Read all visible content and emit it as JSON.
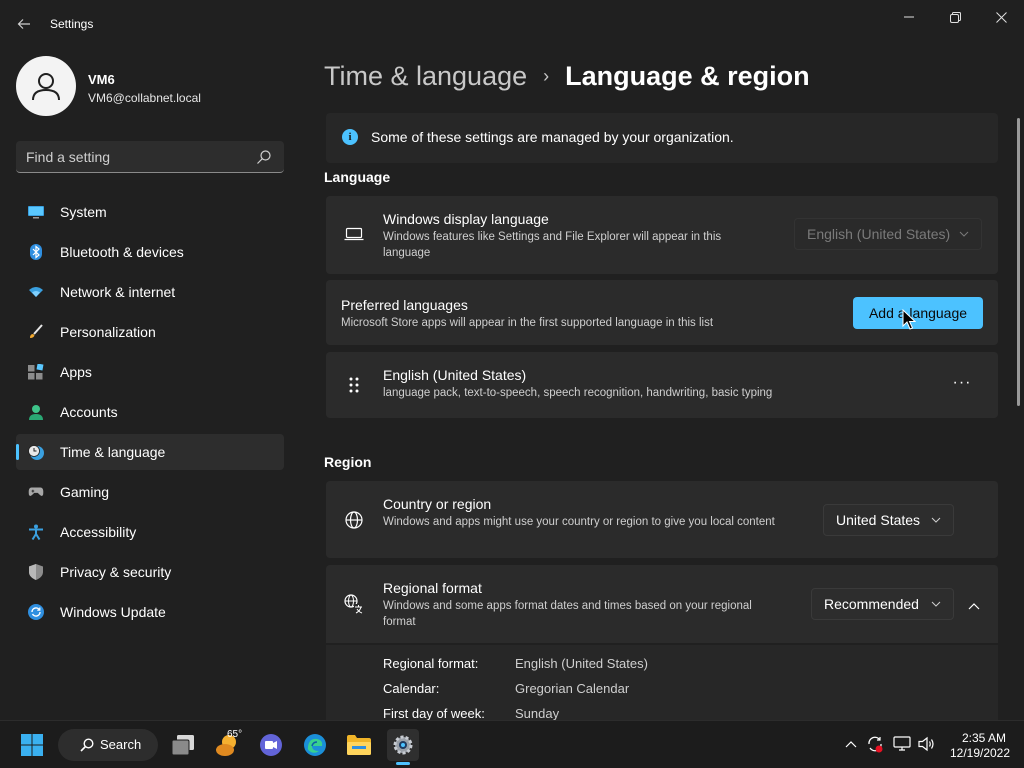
{
  "window": {
    "title": "Settings"
  },
  "profile": {
    "name": "VM6",
    "email": "VM6@collabnet.local"
  },
  "search": {
    "placeholder": "Find a setting"
  },
  "sidebar": {
    "items": [
      {
        "label": "System",
        "icon": "monitor-icon",
        "active": false
      },
      {
        "label": "Bluetooth & devices",
        "icon": "bluetooth-icon",
        "active": false
      },
      {
        "label": "Network & internet",
        "icon": "wifi-icon",
        "active": false
      },
      {
        "label": "Personalization",
        "icon": "brush-icon",
        "active": false
      },
      {
        "label": "Apps",
        "icon": "apps-icon",
        "active": false
      },
      {
        "label": "Accounts",
        "icon": "person-icon",
        "active": false
      },
      {
        "label": "Time & language",
        "icon": "clock-globe-icon",
        "active": true
      },
      {
        "label": "Gaming",
        "icon": "gamepad-icon",
        "active": false
      },
      {
        "label": "Accessibility",
        "icon": "accessibility-icon",
        "active": false
      },
      {
        "label": "Privacy & security",
        "icon": "shield-icon",
        "active": false
      },
      {
        "label": "Windows Update",
        "icon": "update-icon",
        "active": false
      }
    ]
  },
  "breadcrumb": {
    "parent": "Time & language",
    "separator": "›",
    "current": "Language & region"
  },
  "info_bar": {
    "text": "Some of these settings are managed by your organization."
  },
  "language_section": {
    "title": "Language",
    "display_language": {
      "title": "Windows display language",
      "subtitle": "Windows features like Settings and File Explorer will appear in this language",
      "value": "English (United States)"
    },
    "preferred": {
      "title": "Preferred languages",
      "subtitle": "Microsoft Store apps will appear in the first supported language in this list",
      "button": "Add a language"
    },
    "installed": {
      "title": "English (United States)",
      "subtitle": "language pack, text-to-speech, speech recognition, handwriting, basic typing",
      "more": "···"
    }
  },
  "region_section": {
    "title": "Region",
    "country": {
      "title": "Country or region",
      "subtitle": "Windows and apps might use your country or region to give you local content",
      "value": "United States"
    },
    "format": {
      "title": "Regional format",
      "subtitle": "Windows and some apps format dates and times based on your regional format",
      "value": "Recommended"
    },
    "details": [
      {
        "label": "Regional format:",
        "value": "English (United States)"
      },
      {
        "label": "Calendar:",
        "value": "Gregorian Calendar"
      },
      {
        "label": "First day of week:",
        "value": "Sunday"
      }
    ]
  },
  "taskbar": {
    "search_label": "Search",
    "weather_temp": "65°",
    "time": "2:35 AM",
    "date": "12/19/2022"
  },
  "colors": {
    "accent": "#4cc2ff",
    "background": "#202020",
    "card": "#2b2b2b"
  }
}
